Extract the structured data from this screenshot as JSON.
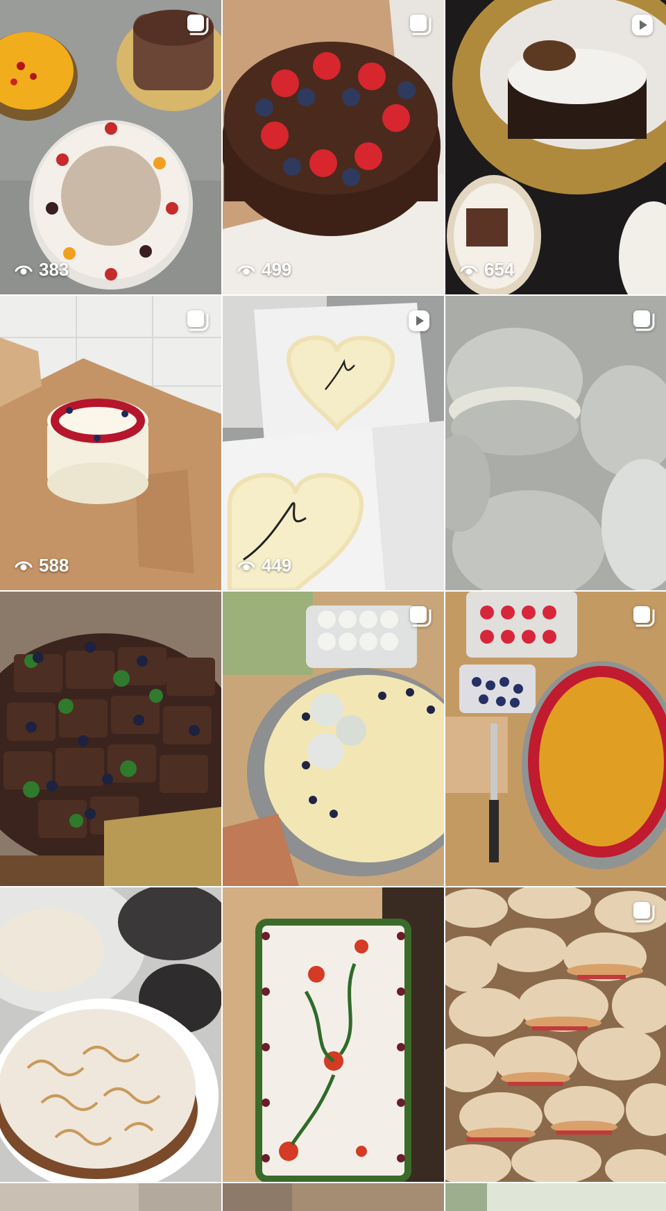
{
  "grid": {
    "tiles": [
      {
        "name": "tile-cakes-overview",
        "type": "carousel",
        "views": "383"
      },
      {
        "name": "tile-chocolate-strawberry-cake",
        "type": "carousel",
        "views": "499"
      },
      {
        "name": "tile-meringue-chocolate-cake",
        "type": "reel",
        "views": "654"
      },
      {
        "name": "tile-berry-cake-in-box",
        "type": "carousel",
        "views": "588"
      },
      {
        "name": "tile-love-heart-cakes",
        "type": "reel",
        "views": "449"
      },
      {
        "name": "tile-macarons",
        "type": "carousel",
        "views": ""
      },
      {
        "name": "tile-brownies-blueberries",
        "type": "none",
        "views": ""
      },
      {
        "name": "tile-macaron-cheesecake",
        "type": "carousel",
        "views": ""
      },
      {
        "name": "tile-mango-berry-cake",
        "type": "carousel",
        "views": ""
      },
      {
        "name": "tile-lemon-meringue-pie",
        "type": "none",
        "views": ""
      },
      {
        "name": "tile-floral-sheet-cake",
        "type": "none",
        "views": ""
      },
      {
        "name": "tile-croissants",
        "type": "carousel",
        "views": ""
      }
    ]
  },
  "colors": {
    "overlay_text": "#ffffff"
  },
  "icons": {
    "carousel": "carousel-icon",
    "reel": "reel-icon",
    "views": "eye-icon"
  }
}
